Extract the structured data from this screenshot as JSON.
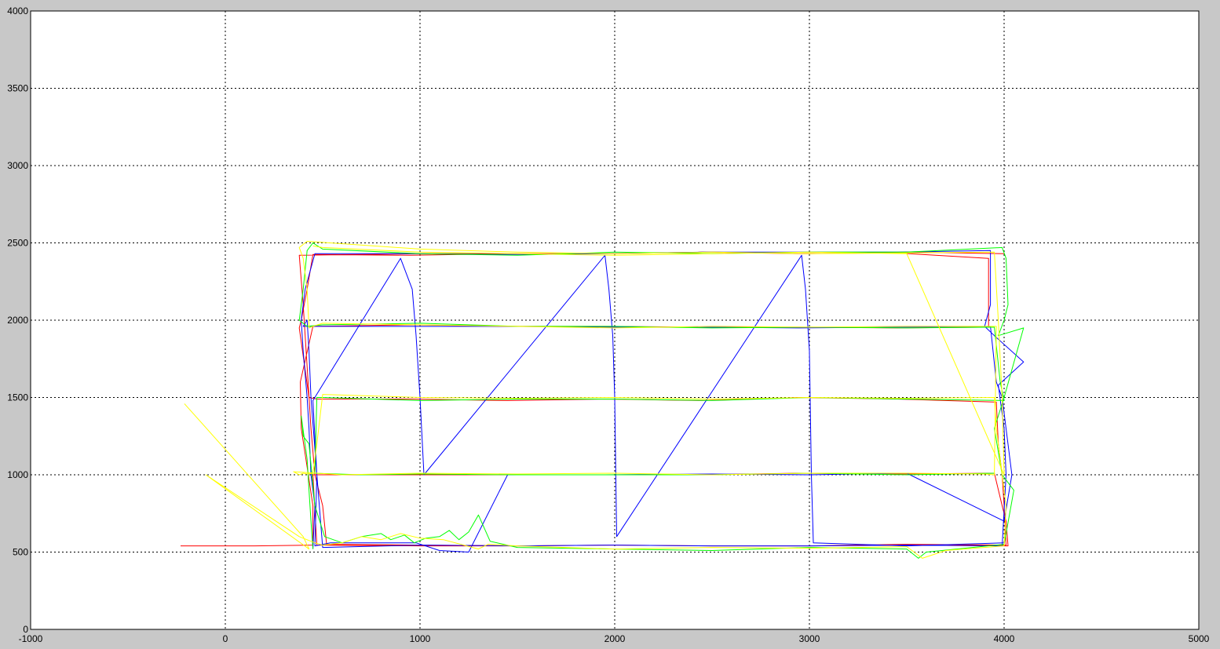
{
  "figure": {
    "background": "#c8c8c8",
    "axes_background": "#ffffff"
  },
  "chart_data": {
    "type": "line",
    "title": "",
    "xlabel": "",
    "ylabel": "",
    "xlim": [
      -1000,
      5000
    ],
    "ylim": [
      0,
      4000
    ],
    "grid": true,
    "grid_style": "dotted",
    "xticks": [
      -1000,
      0,
      1000,
      2000,
      3000,
      4000,
      5000
    ],
    "yticks": [
      0,
      500,
      1000,
      1500,
      2000,
      2500,
      3000,
      3500,
      4000
    ],
    "series": [
      {
        "color": "#ff0000",
        "x": [
          -230,
          150,
          450,
          450,
          420,
          390,
          385,
          450,
          950,
          1450,
          1950,
          2450,
          2950,
          3450,
          3920,
          3920,
          3450,
          2950,
          2450,
          1950,
          1450,
          950,
          450,
          420,
          390,
          380,
          430,
          470,
          950,
          1450,
          1950,
          2450,
          2950,
          3450,
          3960,
          3970,
          3990,
          4000,
          4010,
          3500,
          3000,
          2500,
          2000,
          1500,
          1000,
          470,
          450,
          440,
          450,
          940,
          1450,
          1950,
          2450,
          2950,
          3450,
          3950,
          3990,
          4010,
          4020,
          4000,
          3500,
          3000,
          2500,
          2000,
          1500,
          1000,
          520,
          500,
          460,
          440,
          420,
          400,
          380,
          1000,
          1100,
          1500,
          2000,
          2500,
          3000,
          3500,
          4000
        ],
        "y": [
          540,
          540,
          545,
          800,
          1050,
          1300,
          1600,
          1960,
          1970,
          1960,
          1960,
          1955,
          1955,
          1950,
          1955,
          2400,
          2435,
          2430,
          2440,
          2430,
          2430,
          2420,
          2425,
          2200,
          2000,
          1950,
          1500,
          1490,
          1490,
          1480,
          1490,
          1480,
          1500,
          1490,
          1470,
          1200,
          1000,
          800,
          545,
          550,
          540,
          540,
          545,
          540,
          540,
          545,
          1000,
          1010,
          1000,
          1000,
          1000,
          1000,
          1000,
          1010,
          1005,
          1010,
          800,
          700,
          540,
          540,
          545,
          540,
          540,
          545,
          540,
          545,
          550,
          800,
          1000,
          1300,
          1700,
          2100,
          2420,
          2430,
          2430,
          2430,
          2430,
          2440,
          2430,
          2440,
          2430
        ]
      },
      {
        "color": "#0000ff",
        "x": [
          450,
          460,
          440,
          430,
          420,
          400,
          390,
          410,
          460,
          950,
          1450,
          1950,
          2450,
          2950,
          3450,
          3930,
          3930,
          3900,
          3950,
          4100,
          3970,
          4000,
          4010,
          3990,
          3500,
          3000,
          2500,
          2000,
          1500,
          1000,
          500,
          470,
          440,
          430,
          420,
          400,
          960,
          1450,
          1950,
          2450,
          2950,
          3450,
          3930,
          3960,
          3990,
          4040,
          4000,
          3500,
          3000,
          2500,
          1950,
          1450,
          1250,
          1100,
          980,
          540,
          460,
          470,
          450,
          900,
          960,
          980,
          1000,
          1020,
          1950,
          1970,
          1990,
          2000,
          2010,
          2960,
          2980,
          3000,
          3010,
          3020,
          3500,
          4000
        ],
        "y": [
          520,
          800,
          1000,
          1300,
          1500,
          1800,
          2000,
          2200,
          2430,
          2430,
          2425,
          2430,
          2440,
          2440,
          2440,
          2450,
          2100,
          1960,
          1900,
          1730,
          1580,
          1300,
          1000,
          540,
          545,
          540,
          540,
          545,
          540,
          545,
          530,
          1000,
          1500,
          1800,
          2000,
          1960,
          1960,
          1960,
          1955,
          1955,
          1950,
          1955,
          1960,
          1600,
          1500,
          1000,
          700,
          1010,
          1000,
          1005,
          1000,
          1000,
          500,
          510,
          560,
          560,
          540,
          1000,
          1480,
          2400,
          2200,
          1900,
          1500,
          1000,
          2420,
          2200,
          1900,
          1500,
          600,
          2420,
          2200,
          1800,
          1000,
          560,
          540,
          560
        ]
      },
      {
        "color": "#00ff00",
        "x": [
          450,
          440,
          430,
          420,
          390,
          400,
          430,
          460,
          510,
          600,
          700,
          800,
          850,
          920,
          970,
          1030,
          1100,
          1150,
          1200,
          1250,
          1300,
          1360,
          1500,
          2000,
          2500,
          3000,
          3500,
          3560,
          3600,
          4000,
          4050,
          3990,
          3950,
          4000,
          4100,
          3970,
          4000,
          4020,
          4010,
          3990,
          3500,
          3000,
          2500,
          2000,
          1500,
          1000,
          500,
          450,
          420,
          400,
          380,
          420,
          500,
          1000,
          1500,
          2000,
          2500,
          3000,
          3500,
          3950,
          3980,
          4000,
          3500,
          3000,
          2500,
          2000,
          1500,
          1000,
          500,
          470,
          460,
          450,
          700,
          1000,
          1500,
          2000,
          2500,
          3000,
          3500,
          3950
        ],
        "y": [
          520,
          700,
          900,
          1100,
          1380,
          1250,
          1200,
          800,
          600,
          560,
          600,
          620,
          580,
          610,
          560,
          590,
          600,
          640,
          580,
          630,
          740,
          570,
          530,
          520,
          510,
          530,
          520,
          460,
          500,
          550,
          900,
          1000,
          1300,
          1500,
          1950,
          1900,
          2000,
          2100,
          2400,
          2470,
          2440,
          2440,
          2430,
          2440,
          2420,
          2430,
          2460,
          2500,
          2450,
          2200,
          2000,
          1960,
          1970,
          1980,
          1960,
          1960,
          1950,
          1955,
          1950,
          1955,
          1600,
          1480,
          1490,
          1500,
          1480,
          1490,
          1490,
          1480,
          1500,
          1500,
          1010,
          1010,
          1000,
          1005,
          1000,
          1000,
          1000,
          1010,
          1000,
          1010
        ]
      },
      {
        "color": "#ffff00",
        "x": [
          -210,
          400,
          430,
          -100,
          380,
          460,
          500,
          600,
          700,
          800,
          900,
          1000,
          1120,
          1300,
          1350,
          1500,
          2000,
          2500,
          3000,
          3500,
          3580,
          3700,
          4000,
          4010,
          3990,
          3960,
          3950,
          3500,
          3000,
          2500,
          2000,
          1500,
          1000,
          500,
          470,
          450,
          420,
          400,
          380,
          350,
          600,
          1000,
          1500,
          2000,
          2500,
          3000,
          3500,
          3900,
          3950,
          3960,
          3500,
          3000,
          2500,
          2000,
          1500,
          1000,
          500,
          450,
          430,
          420,
          400,
          380,
          420,
          1000,
          1500,
          2000,
          2500,
          3000,
          3500,
          3950,
          3970,
          3990,
          4000,
          3500,
          3000,
          2500,
          2000,
          1500,
          1000,
          500,
          450
        ],
        "y": [
          1460,
          600,
          520,
          1000,
          600,
          560,
          545,
          560,
          600,
          580,
          620,
          590,
          580,
          520,
          550,
          540,
          520,
          530,
          525,
          535,
          460,
          510,
          540,
          800,
          1000,
          1300,
          1500,
          1495,
          1500,
          1490,
          1500,
          1495,
          1500,
          1520,
          1200,
          1010,
          1005,
          1010,
          1000,
          1020,
          1000,
          1010,
          1005,
          1010,
          1000,
          1010,
          1010,
          1005,
          1000,
          1960,
          1960,
          1955,
          1960,
          1950,
          1960,
          1970,
          1980,
          1960,
          1950,
          2200,
          2400,
          2470,
          2510,
          2460,
          2440,
          2430,
          2440,
          2430,
          2435,
          2440,
          2000,
          1500,
          1000,
          2430,
          2440,
          2430,
          2420,
          2430,
          2440,
          2470,
          2480
        ]
      }
    ]
  }
}
